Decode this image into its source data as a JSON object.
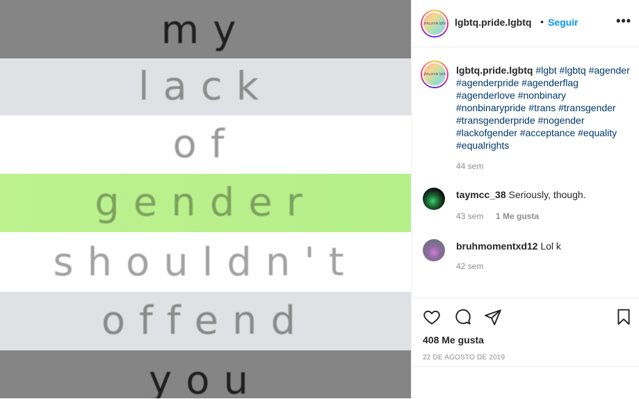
{
  "post": {
    "image_words": [
      "my",
      "lack",
      "of",
      "gender",
      "shouldn't",
      "offend",
      "you"
    ],
    "colors": {
      "gray": "#808080",
      "light_gray": "#dcdfe2",
      "white": "#ffffff",
      "green": "#b9f18e"
    }
  },
  "header": {
    "avatar_text": "lgbtq.pride.lgbtq",
    "username": "lgbtq.pride.lgbtq",
    "separator": "•",
    "follow_label": "Seguir",
    "more_label": "•••"
  },
  "caption": {
    "username": "lgbtq.pride.lgbtq",
    "tags": "#lgbt #lgbtq #agender #agenderpride #agenderflag #agenderlove #nonbinary #nonbinarypride #trans #transgender #transgenderpride #nogender #lackofgender #acceptance #equality #equalrights",
    "time": "44 sem"
  },
  "comments": [
    {
      "username": "taymcc_38",
      "text": "Seriously, though.",
      "time": "43 sem",
      "likes": "1 Me gusta"
    },
    {
      "username": "bruhmomentxd12",
      "text": "Lol k",
      "time": "42 sem"
    }
  ],
  "footer": {
    "likes": "408 Me gusta",
    "date": "22 DE AGOSTO DE 2019"
  }
}
